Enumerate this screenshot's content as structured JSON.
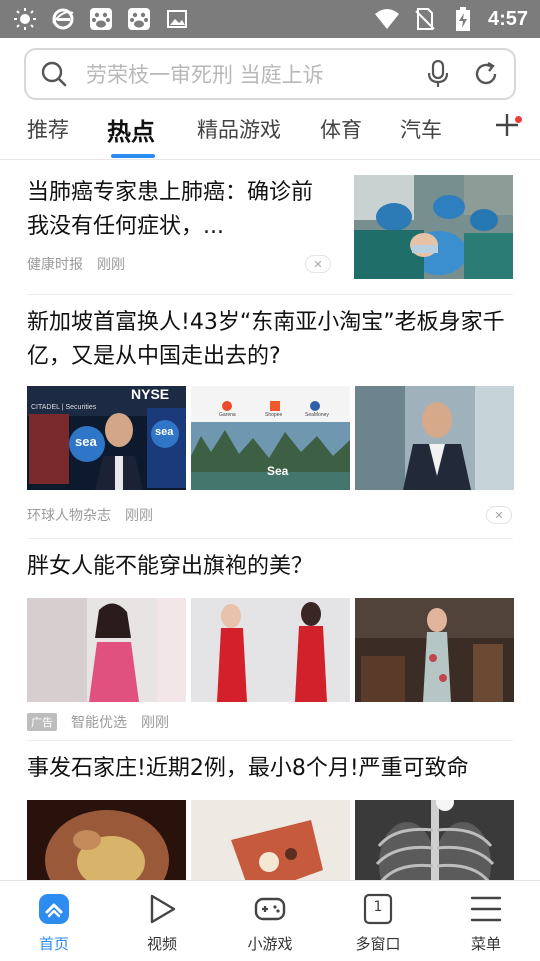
{
  "status_bar": {
    "time": "4:57",
    "left_icons": [
      "brightness-icon",
      "ie-browser-icon",
      "baidu-paw-icon",
      "baidu-paw-icon",
      "image-icon"
    ],
    "right_icons": [
      "wifi-icon",
      "no-sim-icon",
      "battery-charging-icon"
    ]
  },
  "search": {
    "placeholder": "劳荣枝一审死刑 当庭上诉"
  },
  "tabs": [
    {
      "label": "推荐"
    },
    {
      "label": "热点",
      "active": true
    },
    {
      "label": "精品游戏"
    },
    {
      "label": "体育"
    },
    {
      "label": "汽车"
    }
  ],
  "feed": {
    "item1": {
      "title": "当肺癌专家患上肺癌：确诊前我没有任何症状，...",
      "source": "健康时报",
      "time": "刚刚"
    },
    "item2": {
      "title": "新加坡首富换人!43岁“东南亚小淘宝”老板身家千亿，又是从中国走出去的?",
      "source": "环球人物杂志",
      "time": "刚刚",
      "img1_texts": [
        "NYSE",
        "sea",
        "sea",
        "CITADEL | Securities"
      ],
      "img2_texts": [
        "Sea",
        "Garena",
        "Shopee",
        "SeaMoney"
      ]
    },
    "item3": {
      "title": "胖女人能不能穿出旗袍的美？",
      "badge": "广告",
      "source": "智能优选",
      "time": "刚刚"
    },
    "item4": {
      "title": "事发石家庄!近期2例，最小8个月!严重可致命"
    }
  },
  "bottom_nav": [
    {
      "label": "首页",
      "icon": "home-icon",
      "active": true
    },
    {
      "label": "视频",
      "icon": "play-icon"
    },
    {
      "label": "小游戏",
      "icon": "gamepad-icon"
    },
    {
      "label": "多窗口",
      "icon": "windows-icon",
      "badge": "1"
    },
    {
      "label": "菜单",
      "icon": "menu-icon"
    }
  ],
  "colors": {
    "accent": "#2d8cf0",
    "status_bar": "#7c7c7c",
    "notification_dot": "#f23b3b"
  }
}
